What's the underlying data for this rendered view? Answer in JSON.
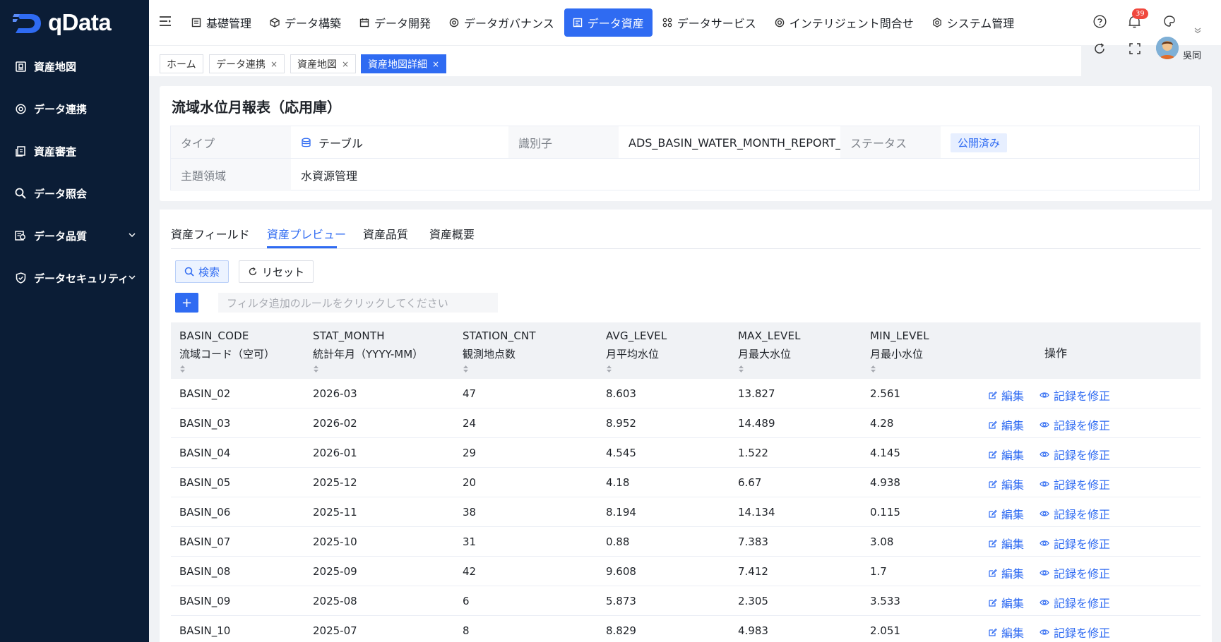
{
  "brand": {
    "name": "qData"
  },
  "sidebar": {
    "items": [
      {
        "label": "資産地図",
        "icon": "asset-map-icon"
      },
      {
        "label": "データ連携",
        "icon": "target-icon"
      },
      {
        "label": "資産審査",
        "icon": "document-icon"
      },
      {
        "label": "データ照会",
        "icon": "search-icon"
      },
      {
        "label": "データ品質",
        "icon": "quality-icon",
        "expandable": true
      },
      {
        "label": "データセキュリティ",
        "icon": "shield-icon",
        "expandable": true
      }
    ]
  },
  "topnav": {
    "items": [
      {
        "label": "基礎管理",
        "icon": "grid-icon"
      },
      {
        "label": "データ構築",
        "icon": "cube-icon"
      },
      {
        "label": "データ開発",
        "icon": "calendar-icon"
      },
      {
        "label": "データガバナンス",
        "icon": "gear-icon"
      },
      {
        "label": "データ資産",
        "icon": "asset-icon",
        "active": true
      },
      {
        "label": "データサービス",
        "icon": "apps-icon"
      },
      {
        "label": "インテリジェント問合せ",
        "icon": "target-icon"
      },
      {
        "label": "システム管理",
        "icon": "settings-icon"
      }
    ],
    "notification_count": "39",
    "username": "吳同",
    "colors": {
      "accent": "#2f6bf2",
      "sidebar": "#0b1d36"
    }
  },
  "tabs_bar": {
    "tags": [
      {
        "label": "ホーム",
        "closable": false
      },
      {
        "label": "データ連携",
        "closable": true
      },
      {
        "label": "資産地図",
        "closable": true
      },
      {
        "label": "資産地図詳細",
        "closable": true,
        "active": true
      }
    ],
    "close_glyph": "×"
  },
  "asset": {
    "title": "流域水位月報表（応用庫）",
    "type_label": "タイプ",
    "type_value": "テーブル",
    "id_label": "識別子",
    "id_value": "ADS_BASIN_WATER_MONTH_REPORT_W",
    "status_label": "ステータス",
    "status_value": "公開済み",
    "domain_label": "主題領域",
    "domain_value": "水資源管理"
  },
  "preview": {
    "tabs": [
      "資産フィールド",
      "資産プレビュー",
      "資産品質",
      "資産概要"
    ],
    "active_tab": 1,
    "search_label": "検索",
    "reset_label": "リセット",
    "add_label": "+",
    "filter_placeholder": "フィルタ追加のルールをクリックしてください"
  },
  "table": {
    "columns": [
      {
        "name": "BASIN_CODE",
        "desc": "流域コード（空可）"
      },
      {
        "name": "STAT_MONTH",
        "desc": "統計年月（YYYY-MM）"
      },
      {
        "name": "STATION_CNT",
        "desc": "観測地点数"
      },
      {
        "name": "AVG_LEVEL",
        "desc": "月平均水位"
      },
      {
        "name": "MAX_LEVEL",
        "desc": "月最大水位"
      },
      {
        "name": "MIN_LEVEL",
        "desc": "月最小水位"
      }
    ],
    "op_header": "操作",
    "edit_label": "編集",
    "fix_label": "記録を修正",
    "rows": [
      [
        "BASIN_02",
        "2026-03",
        "47",
        "8.603",
        "13.827",
        "2.561"
      ],
      [
        "BASIN_03",
        "2026-02",
        "24",
        "8.952",
        "14.489",
        "4.28"
      ],
      [
        "BASIN_04",
        "2026-01",
        "29",
        "4.545",
        "1.522",
        "4.145"
      ],
      [
        "BASIN_05",
        "2025-12",
        "20",
        "4.18",
        "6.67",
        "4.938"
      ],
      [
        "BASIN_06",
        "2025-11",
        "38",
        "8.194",
        "14.134",
        "0.115"
      ],
      [
        "BASIN_07",
        "2025-10",
        "31",
        "0.88",
        "7.383",
        "3.08"
      ],
      [
        "BASIN_08",
        "2025-09",
        "42",
        "9.608",
        "7.412",
        "1.7"
      ],
      [
        "BASIN_09",
        "2025-08",
        "6",
        "5.873",
        "2.305",
        "3.533"
      ],
      [
        "BASIN_10",
        "2025-07",
        "8",
        "8.829",
        "4.983",
        "2.051"
      ]
    ]
  }
}
